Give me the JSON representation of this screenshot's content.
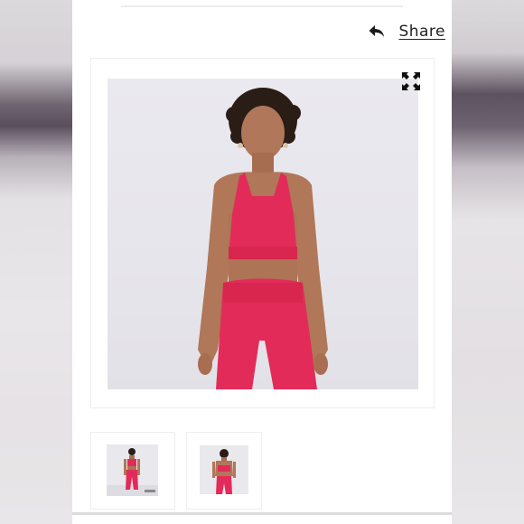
{
  "share": {
    "label": "Share",
    "icon": "reply-arrow-icon"
  },
  "gallery": {
    "expand_icon": "expand-icon",
    "main_image_alt": "",
    "thumbnails": [
      {
        "icon": "thumbnail-front"
      },
      {
        "icon": "thumbnail-back"
      }
    ]
  },
  "colors": {
    "product": "#e32b59",
    "background": "#e8e7ed",
    "text": "#222222"
  }
}
